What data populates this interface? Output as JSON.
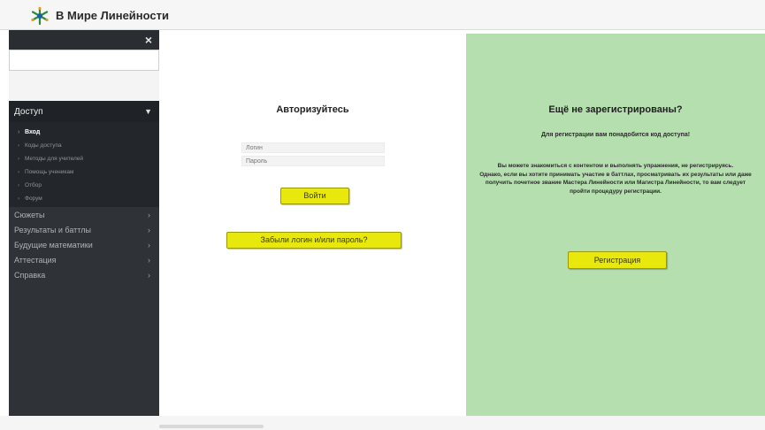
{
  "header": {
    "logo_icon": "snowflake-logo-icon",
    "title": "В Мире Линейности"
  },
  "sidebar": {
    "close_label": "×",
    "section_header": "Доступ",
    "sub_items": [
      {
        "label": "Вход",
        "active": true
      },
      {
        "label": "Коды доступа",
        "active": false
      },
      {
        "label": "Методы для учителей",
        "active": false
      },
      {
        "label": "Помощь ученикам",
        "active": false
      },
      {
        "label": "Отбор",
        "active": false
      },
      {
        "label": "Форум",
        "active": false
      }
    ],
    "items": [
      {
        "label": "Сюжеты"
      },
      {
        "label": "Результаты и баттлы"
      },
      {
        "label": "Будущие математики"
      },
      {
        "label": "Аттестация"
      },
      {
        "label": "Справка"
      }
    ]
  },
  "auth": {
    "title": "Авторизуйтесь",
    "login_placeholder": "Логин",
    "password_placeholder": "Пароль",
    "login_button": "Войти",
    "forgot_button": "Забыли логин и/или пароль?"
  },
  "register": {
    "title": "Ещё не зарегистрированы?",
    "subtitle": "Для регистрации вам понадобится код доступа!",
    "text_1": "Вы можете знакомиться с контентом и выполнять упражнения, не регистрируясь.",
    "text_2": "Однако, если вы хотите принимать участие в баттлах, просматривать их результаты или даже получить почетное звание Мастера Линейности или Магистра Линейности, то вам следует пройти процедуру регистрации.",
    "button": "Регистрация"
  },
  "colors": {
    "sidebar_bg": "#2f3236",
    "green_panel": "#b6dfb0",
    "button_yellow": "#e8e80c"
  }
}
